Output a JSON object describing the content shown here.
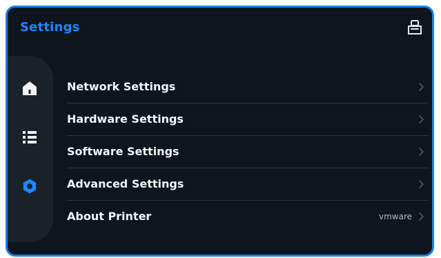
{
  "app": {
    "title": "Settings"
  },
  "topbar": {
    "printer_icon": "printer-icon"
  },
  "sidebar": {
    "items": [
      {
        "icon": "home-icon",
        "active": false
      },
      {
        "icon": "list-icon",
        "active": false
      },
      {
        "icon": "gear-icon",
        "active": true
      }
    ]
  },
  "menu": {
    "items": [
      {
        "label": "Network Settings",
        "value": ""
      },
      {
        "label": "Hardware Settings",
        "value": ""
      },
      {
        "label": "Software Settings",
        "value": ""
      },
      {
        "label": "Advanced Settings",
        "value": ""
      },
      {
        "label": "About Printer",
        "value": "vmware"
      }
    ]
  },
  "colors": {
    "accent": "#1e86ff",
    "frame_border": "#1b80e6",
    "background": "#0f151c",
    "sidebar": "#1a2229",
    "text": "#f2f4f6",
    "muted": "#b3b8bd"
  }
}
